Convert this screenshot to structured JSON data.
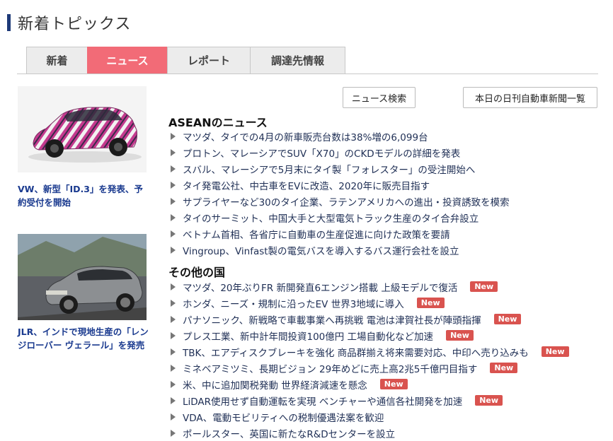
{
  "page_title": "新着トピックス",
  "tabs": [
    {
      "label": "新着"
    },
    {
      "label": "ニュース"
    },
    {
      "label": "レポート"
    },
    {
      "label": "調達先情報"
    }
  ],
  "buttons": {
    "news_search": "ニュース検索",
    "daily_list": "本日の日刊自動車新聞一覧"
  },
  "features": [
    {
      "caption": "VW、新型「ID.3」を発表、予約受付を開始"
    },
    {
      "caption": "JLR、インドで現地生産の「レンジローバー ヴェラール」を発売"
    }
  ],
  "asean": {
    "heading": "ASEANのニュース",
    "items": [
      {
        "text": "マツダ、タイでの4月の新車販売台数は38%増の6,099台"
      },
      {
        "text": "プロトン、マレーシアでSUV「X70」のCKDモデルの詳細を発表"
      },
      {
        "text": "スバル、マレーシアで5月末にタイ製「フォレスター」の受注開始へ"
      },
      {
        "text": "タイ発電公社、中古車をEVに改造、2020年に販売目指す"
      },
      {
        "text": "サプライヤーなど30のタイ企業、ラテンアメリカへの進出・投資誘致を模索"
      },
      {
        "text": "タイのサーミット、中国大手と大型電気トラック生産のタイ合弁設立"
      },
      {
        "text": "ベトナム首相、各省庁に自動車の生産促進に向けた政策を要請"
      },
      {
        "text": "Vingroup、Vinfast製の電気バスを導入するバス運行会社を設立"
      }
    ]
  },
  "others": {
    "heading": "その他の国",
    "badge": "New",
    "items": [
      {
        "text": "マツダ、20年ぶりFR 新開発直6エンジン搭載 上級モデルで復活",
        "new": true
      },
      {
        "text": "ホンダ、ニーズ・規制に沿ったEV 世界3地域に導入",
        "new": true
      },
      {
        "text": "パナソニック、新戦略で車載事業へ再挑戦 電池は津賀社長が陣頭指揮",
        "new": true
      },
      {
        "text": "プレス工業、新中計年間投資100億円 工場自動化など加速",
        "new": true
      },
      {
        "text": "TBK、エアディスクブレーキを強化 商品群揃え将来需要対応、中印へ売り込みも",
        "new": true
      },
      {
        "text": "ミネベアミツミ、長期ビジョン 29年めどに売上高2兆5千億円目指す",
        "new": true
      },
      {
        "text": "米、中に追加関税発動 世界経済減速を懸念",
        "new": true
      },
      {
        "text": "LiDAR使用せず自動運転を実現 ベンチャーや通信各社開発を加速",
        "new": true
      },
      {
        "text": "VDA、電動モビリティへの税制優遇法案を歓迎",
        "new": false
      },
      {
        "text": "ポールスター、英国に新たなR&Dセンターを設立",
        "new": false
      }
    ]
  }
}
